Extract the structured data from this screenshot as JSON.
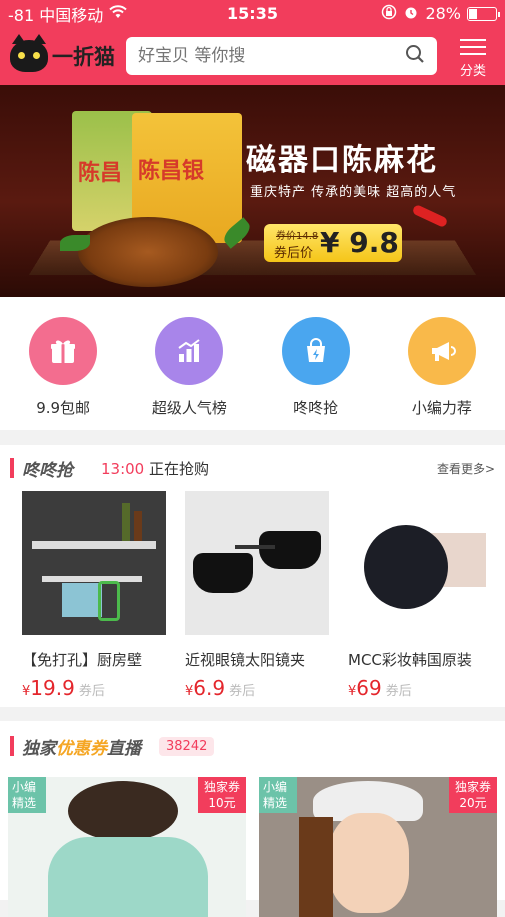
{
  "status_bar": {
    "carrier": "-81 中国移动",
    "time": "15:35",
    "battery": "28%",
    "battery_level": 0.28
  },
  "header": {
    "logo_text": "一折猫",
    "search_placeholder": "好宝贝 等你搜",
    "menu_label": "分类"
  },
  "banner": {
    "title": "磁器口陈麻花",
    "subtitle": "重庆特产 传承的美味 超高的人气",
    "brand_left": "陈昌",
    "brand_right": "陈昌银",
    "old_price": "券价14.8",
    "price_label": "券后价",
    "price": "¥ 9.8"
  },
  "categories": [
    {
      "label": "9.9包邮",
      "icon": "gift-icon",
      "color": "#f36d8f"
    },
    {
      "label": "超级人气榜",
      "icon": "chart-icon",
      "color": "#a885ea"
    },
    {
      "label": "咚咚抢",
      "icon": "bag-icon",
      "color": "#4aa6ef"
    },
    {
      "label": "小编力荐",
      "icon": "megaphone-icon",
      "color": "#f9b94a"
    }
  ],
  "flash_sale": {
    "title": "咚咚抢",
    "time": "13:00",
    "status": "正在抢购",
    "more": "查看更多>",
    "products": [
      {
        "name": "【免打孔】厨房壁",
        "currency": "¥",
        "price": "19.9",
        "suffix": "券后"
      },
      {
        "name": "近视眼镜太阳镜夹",
        "currency": "¥",
        "price": "6.9",
        "suffix": "券后"
      },
      {
        "name": "MCC彩妆韩国原装",
        "currency": "¥",
        "price": "69",
        "suffix": "券后"
      }
    ]
  },
  "coupon_live": {
    "title_a": "独家",
    "title_b": "优惠券",
    "title_c": "直播",
    "count": "38242",
    "cards": [
      {
        "tag_left_1": "小编",
        "tag_left_2": "精选",
        "tag_right_1": "独家券",
        "tag_right_2": "10元"
      },
      {
        "tag_left_1": "小编",
        "tag_left_2": "精选",
        "tag_right_1": "独家券",
        "tag_right_2": "20元"
      }
    ]
  }
}
